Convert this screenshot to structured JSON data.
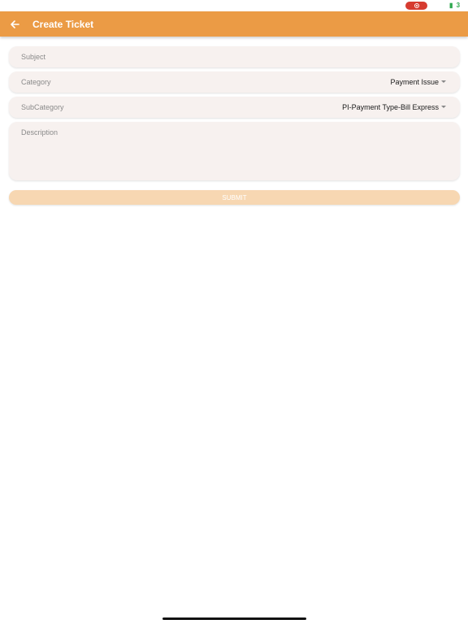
{
  "status_bar": {
    "record_icon": "screen-record-icon",
    "battery_icon": "battery-icon",
    "battery_text": "▮ 3"
  },
  "app_bar": {
    "back_icon": "arrow-left-icon",
    "title": "Create Ticket",
    "color": "#eb9b45"
  },
  "form": {
    "subject": {
      "placeholder": "Subject",
      "value": ""
    },
    "category": {
      "label": "Category",
      "value": "Payment Issue"
    },
    "subcategory": {
      "label": "SubCategory",
      "value": "PI-Payment Type-Bill Express"
    },
    "description": {
      "placeholder": "Description",
      "value": ""
    },
    "submit": {
      "label": "SUBMIT",
      "color": "#f7d7b2"
    }
  }
}
